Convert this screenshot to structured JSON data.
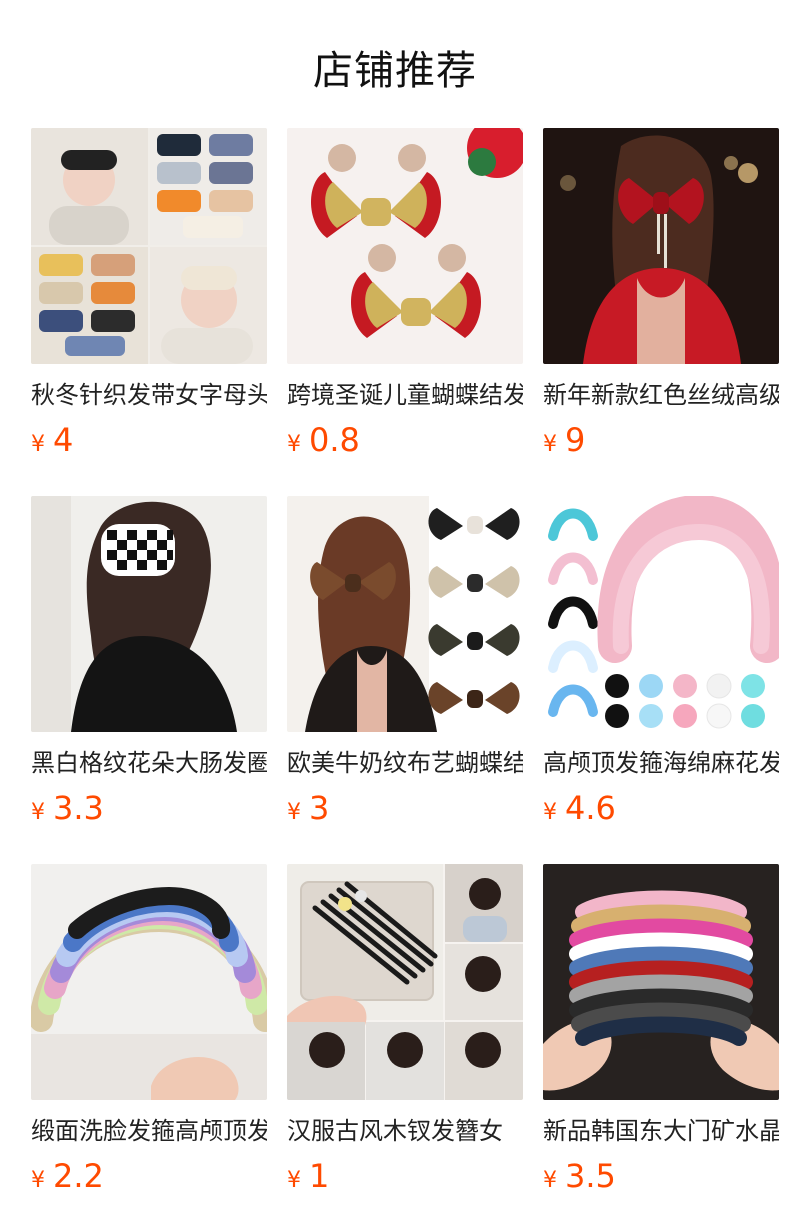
{
  "page": {
    "title": "店铺推荐"
  },
  "products": [
    {
      "name": "秋冬针织发带女字母头巾",
      "currency": "¥",
      "price": "4",
      "image": "knit-headband-photo"
    },
    {
      "name": "跨境圣诞儿童蝴蝶结发夹",
      "currency": "¥",
      "price": "0.8",
      "image": "christmas-bow-hairclip-photo"
    },
    {
      "name": "新年新款红色丝绒高级感",
      "currency": "¥",
      "price": "9",
      "image": "red-velvet-bow-photo"
    },
    {
      "name": "黑白格纹花朵大肠发圈",
      "currency": "¥",
      "price": "3.3",
      "image": "plaid-scrunchie-photo"
    },
    {
      "name": "欧美牛奶纹布艺蝴蝶结",
      "currency": "¥",
      "price": "3",
      "image": "leopard-bow-photo"
    },
    {
      "name": "高颅顶发箍海绵麻花发箍",
      "currency": "¥",
      "price": "4.6",
      "image": "sponge-headband-photo"
    },
    {
      "name": "缎面洗脸发箍高颅顶发箍",
      "currency": "¥",
      "price": "2.2",
      "image": "satin-headband-photo"
    },
    {
      "name": "汉服古风木钗发簪女",
      "currency": "¥",
      "price": "1",
      "image": "hairpin-stick-photo"
    },
    {
      "name": "新品韩国东大门矿水晶",
      "currency": "¥",
      "price": "3.5",
      "image": "crystal-headband-photo"
    }
  ]
}
